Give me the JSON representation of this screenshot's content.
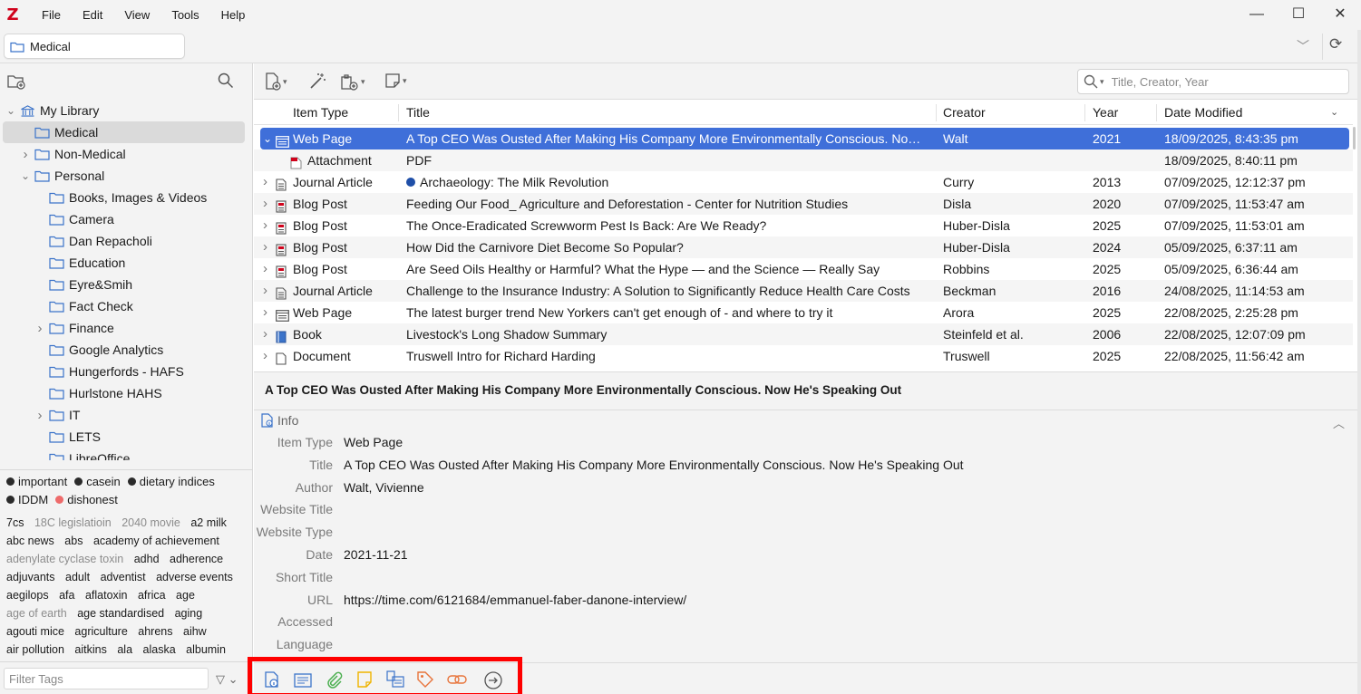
{
  "app": {
    "logo": "Z"
  },
  "menu": [
    "File",
    "Edit",
    "View",
    "Tools",
    "Help"
  ],
  "window_controls": {
    "minimize": "—",
    "maximize": "☐",
    "close": "✕"
  },
  "tab": {
    "label": "Medical"
  },
  "collections": [
    {
      "label": "My Library",
      "level": 0,
      "twisty": "open",
      "icon": "library-icon"
    },
    {
      "label": "Medical",
      "level": 1,
      "twisty": "none",
      "selected": true
    },
    {
      "label": "Non-Medical",
      "level": 1,
      "twisty": "closed"
    },
    {
      "label": "Personal",
      "level": 1,
      "twisty": "open"
    },
    {
      "label": "Books, Images & Videos",
      "level": 2,
      "twisty": "none"
    },
    {
      "label": "Camera",
      "level": 2,
      "twisty": "none"
    },
    {
      "label": "Dan Repacholi",
      "level": 2,
      "twisty": "none"
    },
    {
      "label": "Education",
      "level": 2,
      "twisty": "none"
    },
    {
      "label": "Eyre&Smih",
      "level": 2,
      "twisty": "none"
    },
    {
      "label": "Fact Check",
      "level": 2,
      "twisty": "none"
    },
    {
      "label": "Finance",
      "level": 2,
      "twisty": "closed"
    },
    {
      "label": "Google Analytics",
      "level": 2,
      "twisty": "none"
    },
    {
      "label": "Hungerfords - HAFS",
      "level": 2,
      "twisty": "none"
    },
    {
      "label": "Hurlstone HAHS",
      "level": 2,
      "twisty": "none"
    },
    {
      "label": "IT",
      "level": 2,
      "twisty": "closed"
    },
    {
      "label": "LETS",
      "level": 2,
      "twisty": "none"
    },
    {
      "label": "LibreOffice",
      "level": 2,
      "twisty": "none"
    }
  ],
  "colored_tags": [
    {
      "label": "important",
      "color": "#2b2b2b"
    },
    {
      "label": "casein",
      "color": "#2b2b2b"
    },
    {
      "label": "dietary indices",
      "color": "#2b2b2b"
    },
    {
      "label": "IDDM",
      "color": "#2b2b2b"
    },
    {
      "label": "dishonest",
      "color": "#ee6b6b"
    }
  ],
  "tags": [
    {
      "label": "7cs"
    },
    {
      "label": "18C legislatioin",
      "muted": true
    },
    {
      "label": "2040 movie",
      "muted": true
    },
    {
      "label": "a2 milk"
    },
    {
      "label": "abc news"
    },
    {
      "label": "abs"
    },
    {
      "label": "academy of achievement"
    },
    {
      "label": "adenylate cyclase toxin",
      "muted": true
    },
    {
      "label": "adhd"
    },
    {
      "label": "adherence"
    },
    {
      "label": "adjuvants"
    },
    {
      "label": "adult"
    },
    {
      "label": "adventist"
    },
    {
      "label": "adverse events"
    },
    {
      "label": "aegilops"
    },
    {
      "label": "afa"
    },
    {
      "label": "aflatoxin"
    },
    {
      "label": "africa"
    },
    {
      "label": "age"
    },
    {
      "label": "age of earth",
      "muted": true
    },
    {
      "label": "age standardised"
    },
    {
      "label": "aging"
    },
    {
      "label": "agouti mice"
    },
    {
      "label": "agriculture"
    },
    {
      "label": "ahrens"
    },
    {
      "label": "aihw"
    },
    {
      "label": "air pollution"
    },
    {
      "label": "aitkins"
    },
    {
      "label": "ala"
    },
    {
      "label": "alaska"
    },
    {
      "label": "albumin"
    }
  ],
  "tag_filter": {
    "placeholder": "Filter Tags"
  },
  "search": {
    "placeholder": "Title, Creator, Year"
  },
  "columns": {
    "type": "Item Type",
    "title": "Title",
    "creator": "Creator",
    "year": "Year",
    "date": "Date Modified"
  },
  "items": [
    {
      "twisty": "open",
      "icon": "webpage",
      "type": "Web Page",
      "title": "A Top CEO Was Ousted After Making His Company More Environmentally Conscious. Now He's Speaking Out",
      "creator": "Walt",
      "year": "2021",
      "date": "18/09/2025, 8:43:35 pm",
      "selected": true
    },
    {
      "twisty": "none",
      "icon": "pdf",
      "type": "Attachment",
      "title": "PDF",
      "creator": "",
      "year": "",
      "date": "18/09/2025, 8:40:11 pm",
      "child": true
    },
    {
      "twisty": "closed",
      "icon": "article",
      "type": "Journal Article",
      "title": "Archaeology: The Milk Revolution",
      "creator": "Curry",
      "year": "2013",
      "date": "07/09/2025, 12:12:37 pm",
      "tag_color": "#1f4fa8"
    },
    {
      "twisty": "closed",
      "icon": "blog",
      "type": "Blog Post",
      "title": "Feeding Our Food_ Agriculture and Deforestation - Center for Nutrition Studies",
      "creator": "Disla",
      "year": "2020",
      "date": "07/09/2025, 11:53:47 am"
    },
    {
      "twisty": "closed",
      "icon": "blog",
      "type": "Blog Post",
      "title": "The Once-Eradicated Screwworm Pest Is Back: Are We Ready?",
      "creator": "Huber-Disla",
      "year": "2025",
      "date": "07/09/2025, 11:53:01 am"
    },
    {
      "twisty": "closed",
      "icon": "blog",
      "type": "Blog Post",
      "title": "How Did the Carnivore Diet Become So Popular?",
      "creator": "Huber-Disla",
      "year": "2024",
      "date": "05/09/2025, 6:37:11 am"
    },
    {
      "twisty": "closed",
      "icon": "blog",
      "type": "Blog Post",
      "title": "Are Seed Oils Healthy or Harmful? What the Hype — and the Science — Really Say",
      "creator": "Robbins",
      "year": "2025",
      "date": "05/09/2025, 6:36:44 am"
    },
    {
      "twisty": "closed",
      "icon": "article",
      "type": "Journal Article",
      "title": "Challenge to the Insurance Industry: A Solution to Significantly Reduce Health Care Costs",
      "creator": "Beckman",
      "year": "2016",
      "date": "24/08/2025, 11:14:53 am"
    },
    {
      "twisty": "closed",
      "icon": "webpage",
      "type": "Web Page",
      "title": "The latest burger trend New Yorkers can't get enough of - and where to try it",
      "creator": "Arora",
      "year": "2025",
      "date": "22/08/2025, 2:25:28 pm"
    },
    {
      "twisty": "closed",
      "icon": "book",
      "type": "Book",
      "title": "Livestock's Long Shadow Summary",
      "creator": "Steinfeld et al.",
      "year": "2006",
      "date": "22/08/2025, 12:07:09 pm"
    },
    {
      "twisty": "closed",
      "icon": "document",
      "type": "Document",
      "title": "Truswell Intro for Richard Harding",
      "creator": "Truswell",
      "year": "2025",
      "date": "22/08/2025, 11:56:42 am"
    }
  ],
  "item_pane": {
    "title": "A Top CEO Was Ousted After Making His Company More Environmentally Conscious. Now He's Speaking Out",
    "section": "Info",
    "fields": [
      {
        "label": "Item Type",
        "value": "Web Page"
      },
      {
        "label": "Title",
        "value": "A Top CEO Was Ousted After Making His Company More Environmentally Conscious. Now He's Speaking Out"
      },
      {
        "label": "Author",
        "value": "Walt, Vivienne"
      },
      {
        "label": "Website Title",
        "value": ""
      },
      {
        "label": "Website Type",
        "value": ""
      },
      {
        "label": "Date",
        "value": "2021-11-21"
      },
      {
        "label": "Short Title",
        "value": ""
      },
      {
        "label": "URL",
        "value": "https://time.com/6121684/emmanuel-faber-danone-interview/"
      },
      {
        "label": "Accessed",
        "value": ""
      },
      {
        "label": "Language",
        "value": ""
      }
    ]
  },
  "colors": {
    "selection": "#3f6fd9",
    "highlight_box": "#ff0000",
    "accent_blue": "#3b73c9",
    "accent_green": "#4caf50",
    "accent_yellow": "#f0b400",
    "accent_orange": "#e8743b"
  }
}
